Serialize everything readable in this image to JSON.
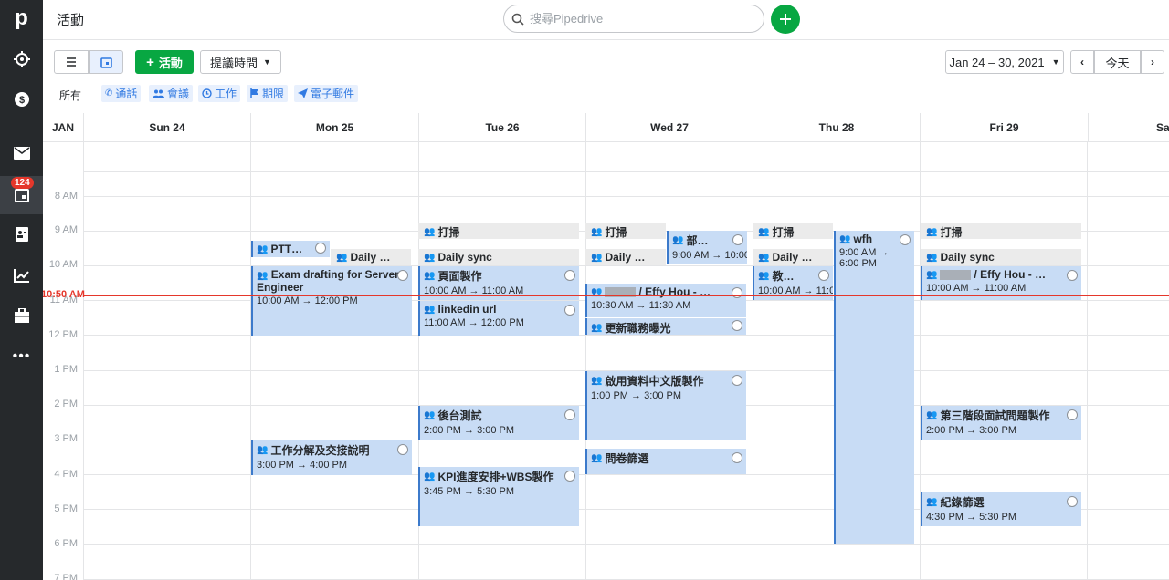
{
  "app": {
    "title": "活動",
    "logo": "p"
  },
  "search": {
    "placeholder": "搜尋Pipedrive"
  },
  "sidebar": {
    "badge_count": "124"
  },
  "toolbar": {
    "add_activity_label": "活動",
    "reminder_label": "提議時間",
    "date_range": "Jan 24 – 30, 2021",
    "today_label": "今天"
  },
  "filters": {
    "all": "所有",
    "items": [
      "通話",
      "會議",
      "工作",
      "期限",
      "電子郵件"
    ]
  },
  "calendar": {
    "month": "JAN",
    "days": [
      "Sun 24",
      "Mon 25",
      "Tue 26",
      "Wed 27",
      "Thu 28",
      "Fri 29",
      "Sa"
    ],
    "hours": [
      "8 AM",
      "9 AM",
      "10 AM",
      "11 AM",
      "12 PM",
      "1 PM",
      "2 PM",
      "3 PM",
      "4 PM",
      "5 PM",
      "6 PM",
      "7 PM"
    ],
    "now_label": "10:50 AM",
    "events": [
      {
        "title": "PTT…"
      },
      {
        "title": "Daily …"
      },
      {
        "title": "Exam drafting for Server Engineer",
        "time": "10:00 AM → 12:00 PM"
      },
      {
        "title": "工作分解及交接說明",
        "time": "3:00 PM → 4:00 PM"
      },
      {
        "title": "打掃"
      },
      {
        "title": "Daily sync"
      },
      {
        "title": "頁面製作",
        "time": "10:00 AM → 11:00 AM"
      },
      {
        "title": "linkedin url",
        "time": "11:00 AM → 12:00 PM"
      },
      {
        "title": "後台測試",
        "time": "2:00 PM → 3:00 PM"
      },
      {
        "title": "KPI進度安排+WBS製作",
        "time": "3:45 PM → 5:30 PM"
      },
      {
        "title": "打掃"
      },
      {
        "title": "Daily …"
      },
      {
        "title": "部…",
        "time": "9:00 AM → 10:00"
      },
      {
        "title": "/ Effy Hou - …",
        "time": "10:30 AM → 11:30 AM"
      },
      {
        "title": "更新職務曝光"
      },
      {
        "title": "啟用資料中文版製作",
        "time": "1:00 PM → 3:00 PM"
      },
      {
        "title": "問卷篩選"
      },
      {
        "title": "打掃"
      },
      {
        "title": "Daily …"
      },
      {
        "title": "教…",
        "time": "10:00 AM → 11:0"
      },
      {
        "title": "wfh",
        "time": "9:00 AM →",
        "time2": "6:00 PM"
      },
      {
        "title": "打掃"
      },
      {
        "title": "Daily sync"
      },
      {
        "title": "/ Effy Hou - …",
        "time": "10:00 AM → 11:00 AM"
      },
      {
        "title": "第三階段面試問題製作",
        "time": "2:00 PM → 3:00 PM"
      },
      {
        "title": "紀錄篩選",
        "time": "4:30 PM → 5:30 PM"
      }
    ]
  },
  "colors": {
    "accent": "#08a742",
    "event_bg": "#c8dcf5",
    "now_line": "#e5372b",
    "sidebar": "#26292c"
  }
}
